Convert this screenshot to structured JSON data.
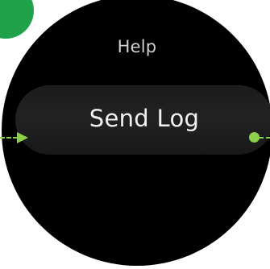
{
  "screen": {
    "title": "Help"
  },
  "menu": {
    "send_log_label": "Send Log"
  },
  "annotations": {
    "accent_color": "#8bd14a",
    "badge_color": "#1fa24a"
  }
}
